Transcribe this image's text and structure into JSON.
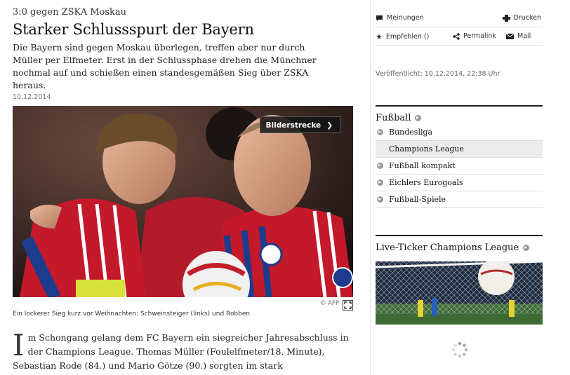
{
  "article": {
    "kicker": "3:0 gegen ZSKA Moskau",
    "headline": "Starker Schlussspurt der Bayern",
    "teaser": "Die Bayern sind gegen Moskau überlegen, treffen aber nur durch Müller per Elfmeter. Erst in der Schlussphase drehen die Münchner nochmal auf und schießen einen standesgemäßen Sieg über ZSKA heraus.",
    "date": "10.12.2014",
    "gallery_label": "Bilderstrecke",
    "credit": "© AFP",
    "caption": "Ein lockerer Sieg kurz vor Weihnachten: Schweinsteiger (links) und Robben",
    "dropcap": "I",
    "body": "m Schongang gelang dem FC Bayern ein siegreicher Jahresabschluss in der Champions League. Thomas Müller (Foulelfmeter/18. Minute), Sebastian Rode (84.) und Mario Götze (90.) sorgten im stark durchgemischten Team des"
  },
  "tools": {
    "opinions": "Meinungen",
    "print": "Drucken",
    "recommend": "Empfehlen ()",
    "permalink": "Permalink",
    "mail": "Mail"
  },
  "published": "Veröffentlicht: 10.12.2014, 22:38 Uhr",
  "football": {
    "title": "Fußball",
    "items": [
      "Bundesliga",
      "Champions League",
      "Fußball kompakt",
      "Eichlers Eurogoals",
      "Fußball-Spiele"
    ]
  },
  "ticker": {
    "title": "Live-Ticker Champions League"
  },
  "icons": [
    "speech-bubble-icon",
    "printer-icon",
    "star-icon",
    "share-icon",
    "envelope-icon",
    "chevron-right-icon",
    "expand-icon",
    "circle-arrow-icon",
    "loading-spinner-icon"
  ],
  "colors": {
    "text": "#111111",
    "muted": "#777777",
    "rule": "#dcdcdc",
    "active": "#ececec"
  }
}
